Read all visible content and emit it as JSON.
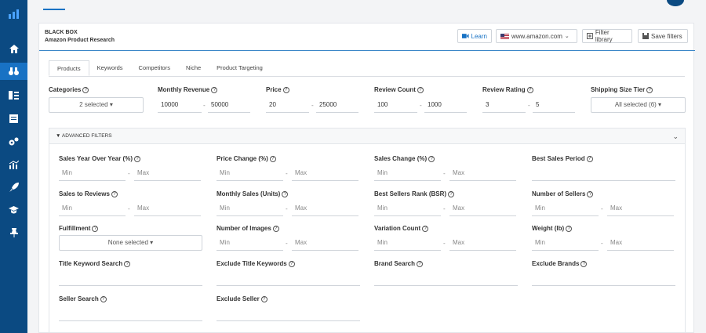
{
  "sidebar": {
    "icons": [
      "logo-bars-icon",
      "home-icon",
      "binoculars-icon",
      "keyword-icon",
      "list-icon",
      "gears-icon",
      "chart-icon",
      "rocket-icon",
      "graduation-cap-icon",
      "pin-icon"
    ]
  },
  "panel": {
    "title": "BLACK BOX",
    "subtitle": "Amazon Product Research",
    "learn_label": "Learn",
    "marketplace": "www.amazon.com",
    "filter_library_label": "Filter library",
    "save_filters_label": "Save filters"
  },
  "tabs": [
    {
      "label": "Products"
    },
    {
      "label": "Keywords"
    },
    {
      "label": "Competitors"
    },
    {
      "label": "Niche"
    },
    {
      "label": "Product Targeting"
    }
  ],
  "main_filters": {
    "categories": {
      "label": "Categories",
      "value": "2 selected"
    },
    "monthly_revenue": {
      "label": "Monthly Revenue",
      "min": "10000",
      "max": "50000"
    },
    "price": {
      "label": "Price",
      "min": "20",
      "max": "25000"
    },
    "review_count": {
      "label": "Review Count",
      "min": "100",
      "max": "1000"
    },
    "review_rating": {
      "label": "Review Rating",
      "min": "3",
      "max": "5"
    },
    "shipping_size": {
      "label": "Shipping Size Tier",
      "value": "All selected (6)"
    }
  },
  "range_dash": "-",
  "advanced": {
    "title": "ADVANCED FILTERS",
    "min_placeholder": "Min",
    "max_placeholder": "Max",
    "labels": {
      "sales_yoy": "Sales Year Over Year (%)",
      "price_change": "Price Change (%)",
      "sales_change": "Sales Change (%)",
      "best_sales_period": "Best Sales Period",
      "sales_to_reviews": "Sales to Reviews",
      "monthly_sales": "Monthly Sales (Units)",
      "bsr": "Best Sellers Rank (BSR)",
      "num_sellers": "Number of Sellers",
      "fulfillment": "Fulfillment",
      "num_images": "Number of Images",
      "variation_count": "Variation Count",
      "weight": "Weight (lb)",
      "title_keyword": "Title Keyword Search",
      "exclude_title": "Exclude Title Keywords",
      "brand_search": "Brand Search",
      "exclude_brands": "Exclude Brands",
      "seller_search": "Seller Search",
      "exclude_seller": "Exclude Seller"
    },
    "fulfillment_value": "None selected"
  }
}
